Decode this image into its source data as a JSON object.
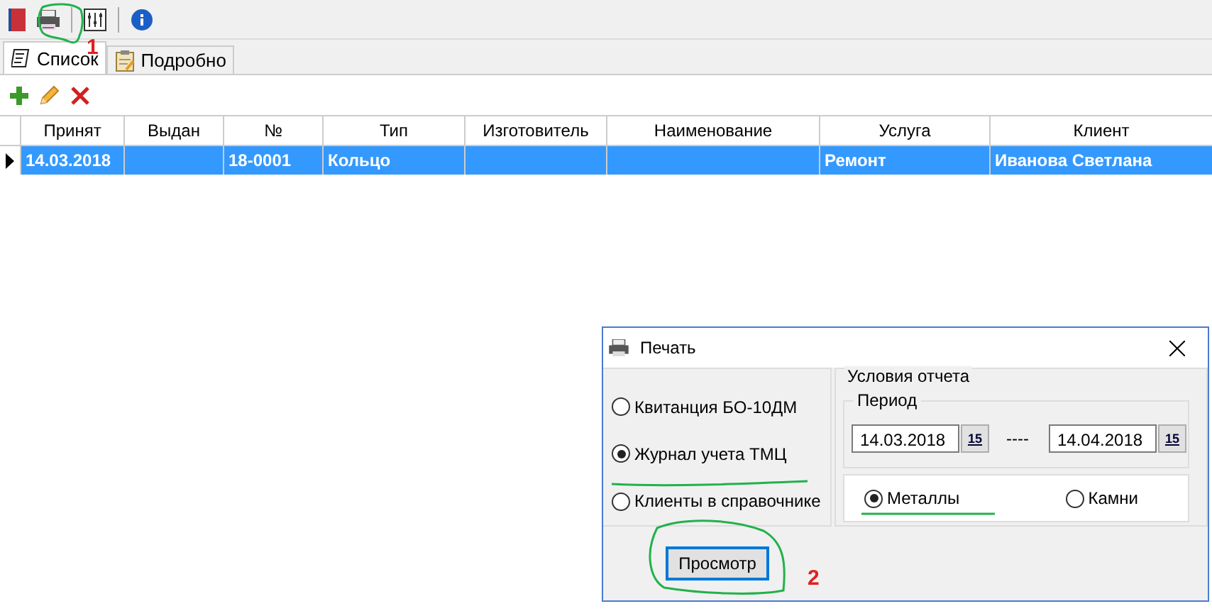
{
  "toolbar": {
    "items": [
      {
        "kind": "book"
      },
      {
        "kind": "printer"
      },
      {
        "kind": "sliders"
      },
      {
        "kind": "info"
      }
    ]
  },
  "tabs": [
    {
      "label": "Список",
      "kind": "notes",
      "selected": true
    },
    {
      "label": "Подробно",
      "kind": "clipboard",
      "selected": false
    }
  ],
  "actions": [
    {
      "kind": "add"
    },
    {
      "kind": "edit"
    },
    {
      "kind": "delete"
    }
  ],
  "table": {
    "columns": [
      "Принят",
      "Выдан",
      "№",
      "Тип",
      "Изготовитель",
      "Наименование",
      "Услуга",
      "Клиент"
    ],
    "rows": [
      {
        "selected": true,
        "current": true,
        "cells": [
          "14.03.2018",
          "",
          "18-0001",
          "Кольцо",
          "",
          "",
          "Ремонт",
          "Иванова Светлана"
        ]
      }
    ]
  },
  "dialog": {
    "title": "Печать",
    "reports": [
      {
        "label": "Квитанция БО-10ДМ",
        "selected": false
      },
      {
        "label": "Журнал учета ТМЦ",
        "selected": true
      },
      {
        "label": "Клиенты в справочнике",
        "selected": false
      }
    ],
    "conditions_title": "Условия отчета",
    "period": {
      "title": "Период",
      "from": "14.03.2018",
      "from_calendar": "15",
      "separator": "----",
      "to": "14.04.2018",
      "to_calendar": "15"
    },
    "materials": [
      {
        "label": "Металлы",
        "selected": true
      },
      {
        "label": "Камни",
        "selected": false
      }
    ],
    "button": "Просмотр"
  },
  "markers": [
    "1",
    "2"
  ]
}
